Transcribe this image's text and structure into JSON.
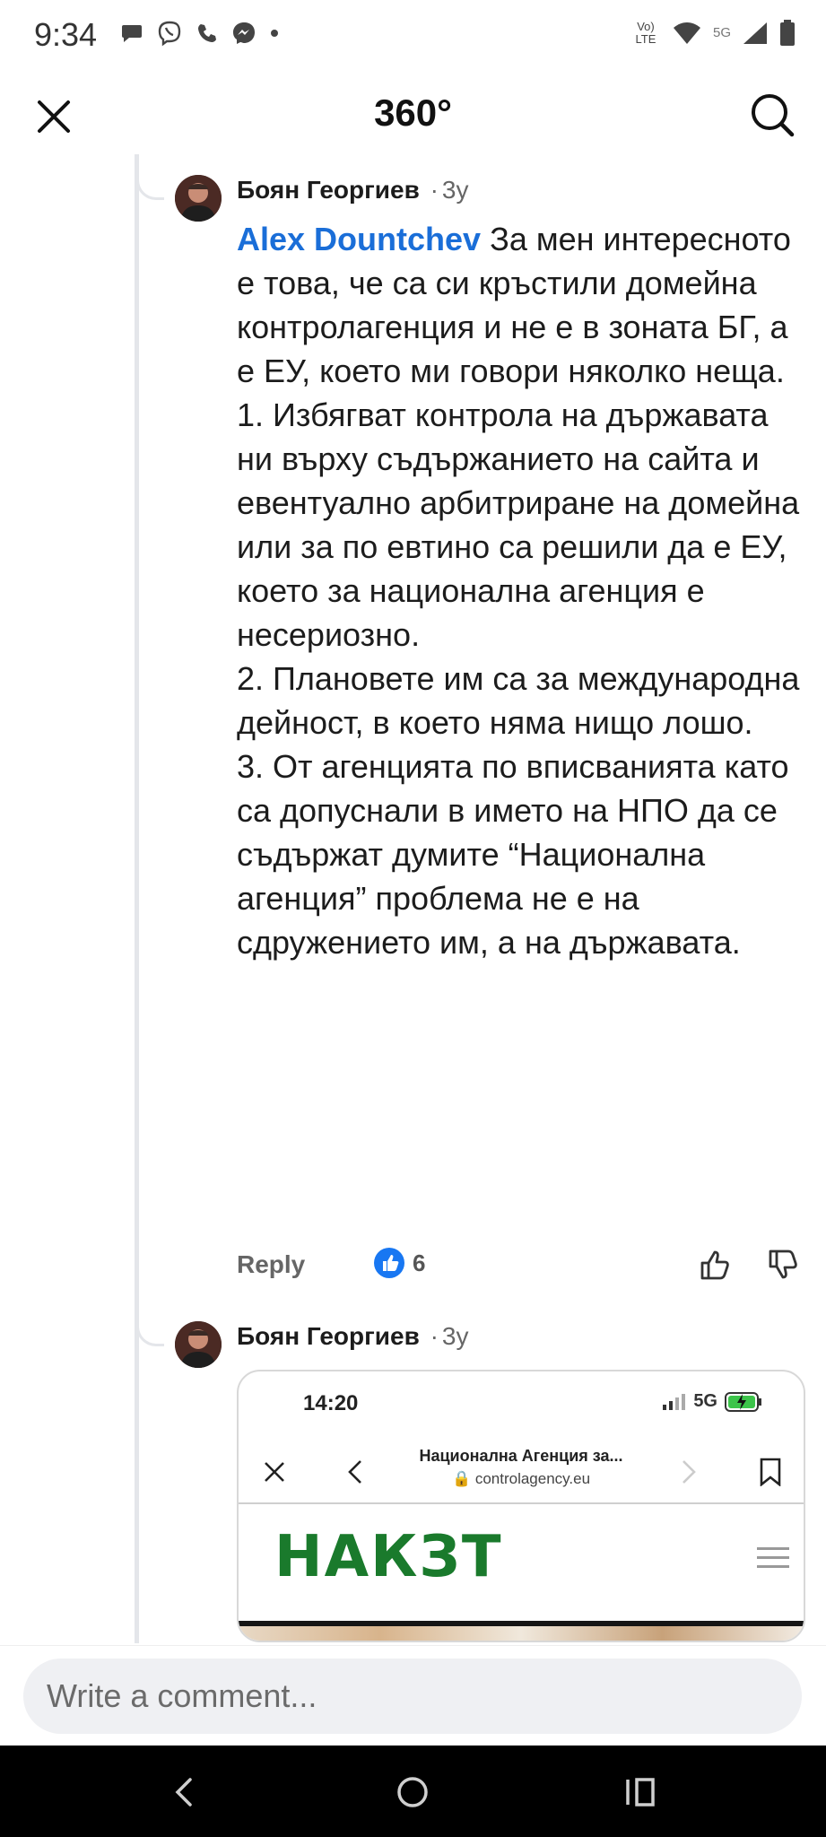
{
  "status_bar": {
    "time": "9:34",
    "volte_label": "Vo) LTE",
    "network_label": "5G",
    "left_icons": [
      "chat-bubble-icon",
      "viber-icon",
      "phone-icon",
      "messenger-icon",
      "dot-icon"
    ],
    "right_icons": [
      "volte-icon",
      "wifi-icon",
      "5g-icon",
      "signal-icon",
      "battery-icon"
    ]
  },
  "header": {
    "title": "360°",
    "close_icon": "close-icon",
    "search_icon": "search-icon"
  },
  "comments": [
    {
      "author": "Боян Георгиев",
      "separator": "·",
      "time": "3y",
      "mention": "Alex Dountchev",
      "paragraphs": [
        "За мен интересното е това, че са си кръстили домейна контролагенция и не е в зоната БГ, а е ЕУ, което ми говори няколко неща.",
        "1. Избягват контрола на държавата ни върху съдържанието на сайта и евентуално арбитриране на домейна или за по евтино са решили да е ЕУ, което за национална агенция е несериозно.",
        "2. Плановете им са за международна дейност, в което няма нищо лошо.",
        "3. От агенцията по вписванията като са допуснали в името на НПО да се съдържат думите “Национална агенция” проблема не е на сдружението им, а на държавата."
      ],
      "reply_label": "Reply",
      "reaction_count": "6",
      "reaction_icon": "thumbs-up-reaction-icon"
    },
    {
      "author": "Боян Георгиев",
      "separator": "·",
      "time": "3y",
      "embed": {
        "time": "14:20",
        "network": "5G",
        "page_title": "Национална Агенция за...",
        "url": "controlagency.eu",
        "logo_text": "НАКЗТ"
      }
    }
  ],
  "comment_input": {
    "placeholder": "Write a comment..."
  },
  "navigation": {
    "back_icon": "back-icon",
    "home_icon": "home-icon",
    "recents_icon": "recents-icon"
  },
  "colors": {
    "mention": "#1a6ed8",
    "reaction_blue": "#1877f2",
    "logo_green": "#1a7a2c"
  }
}
